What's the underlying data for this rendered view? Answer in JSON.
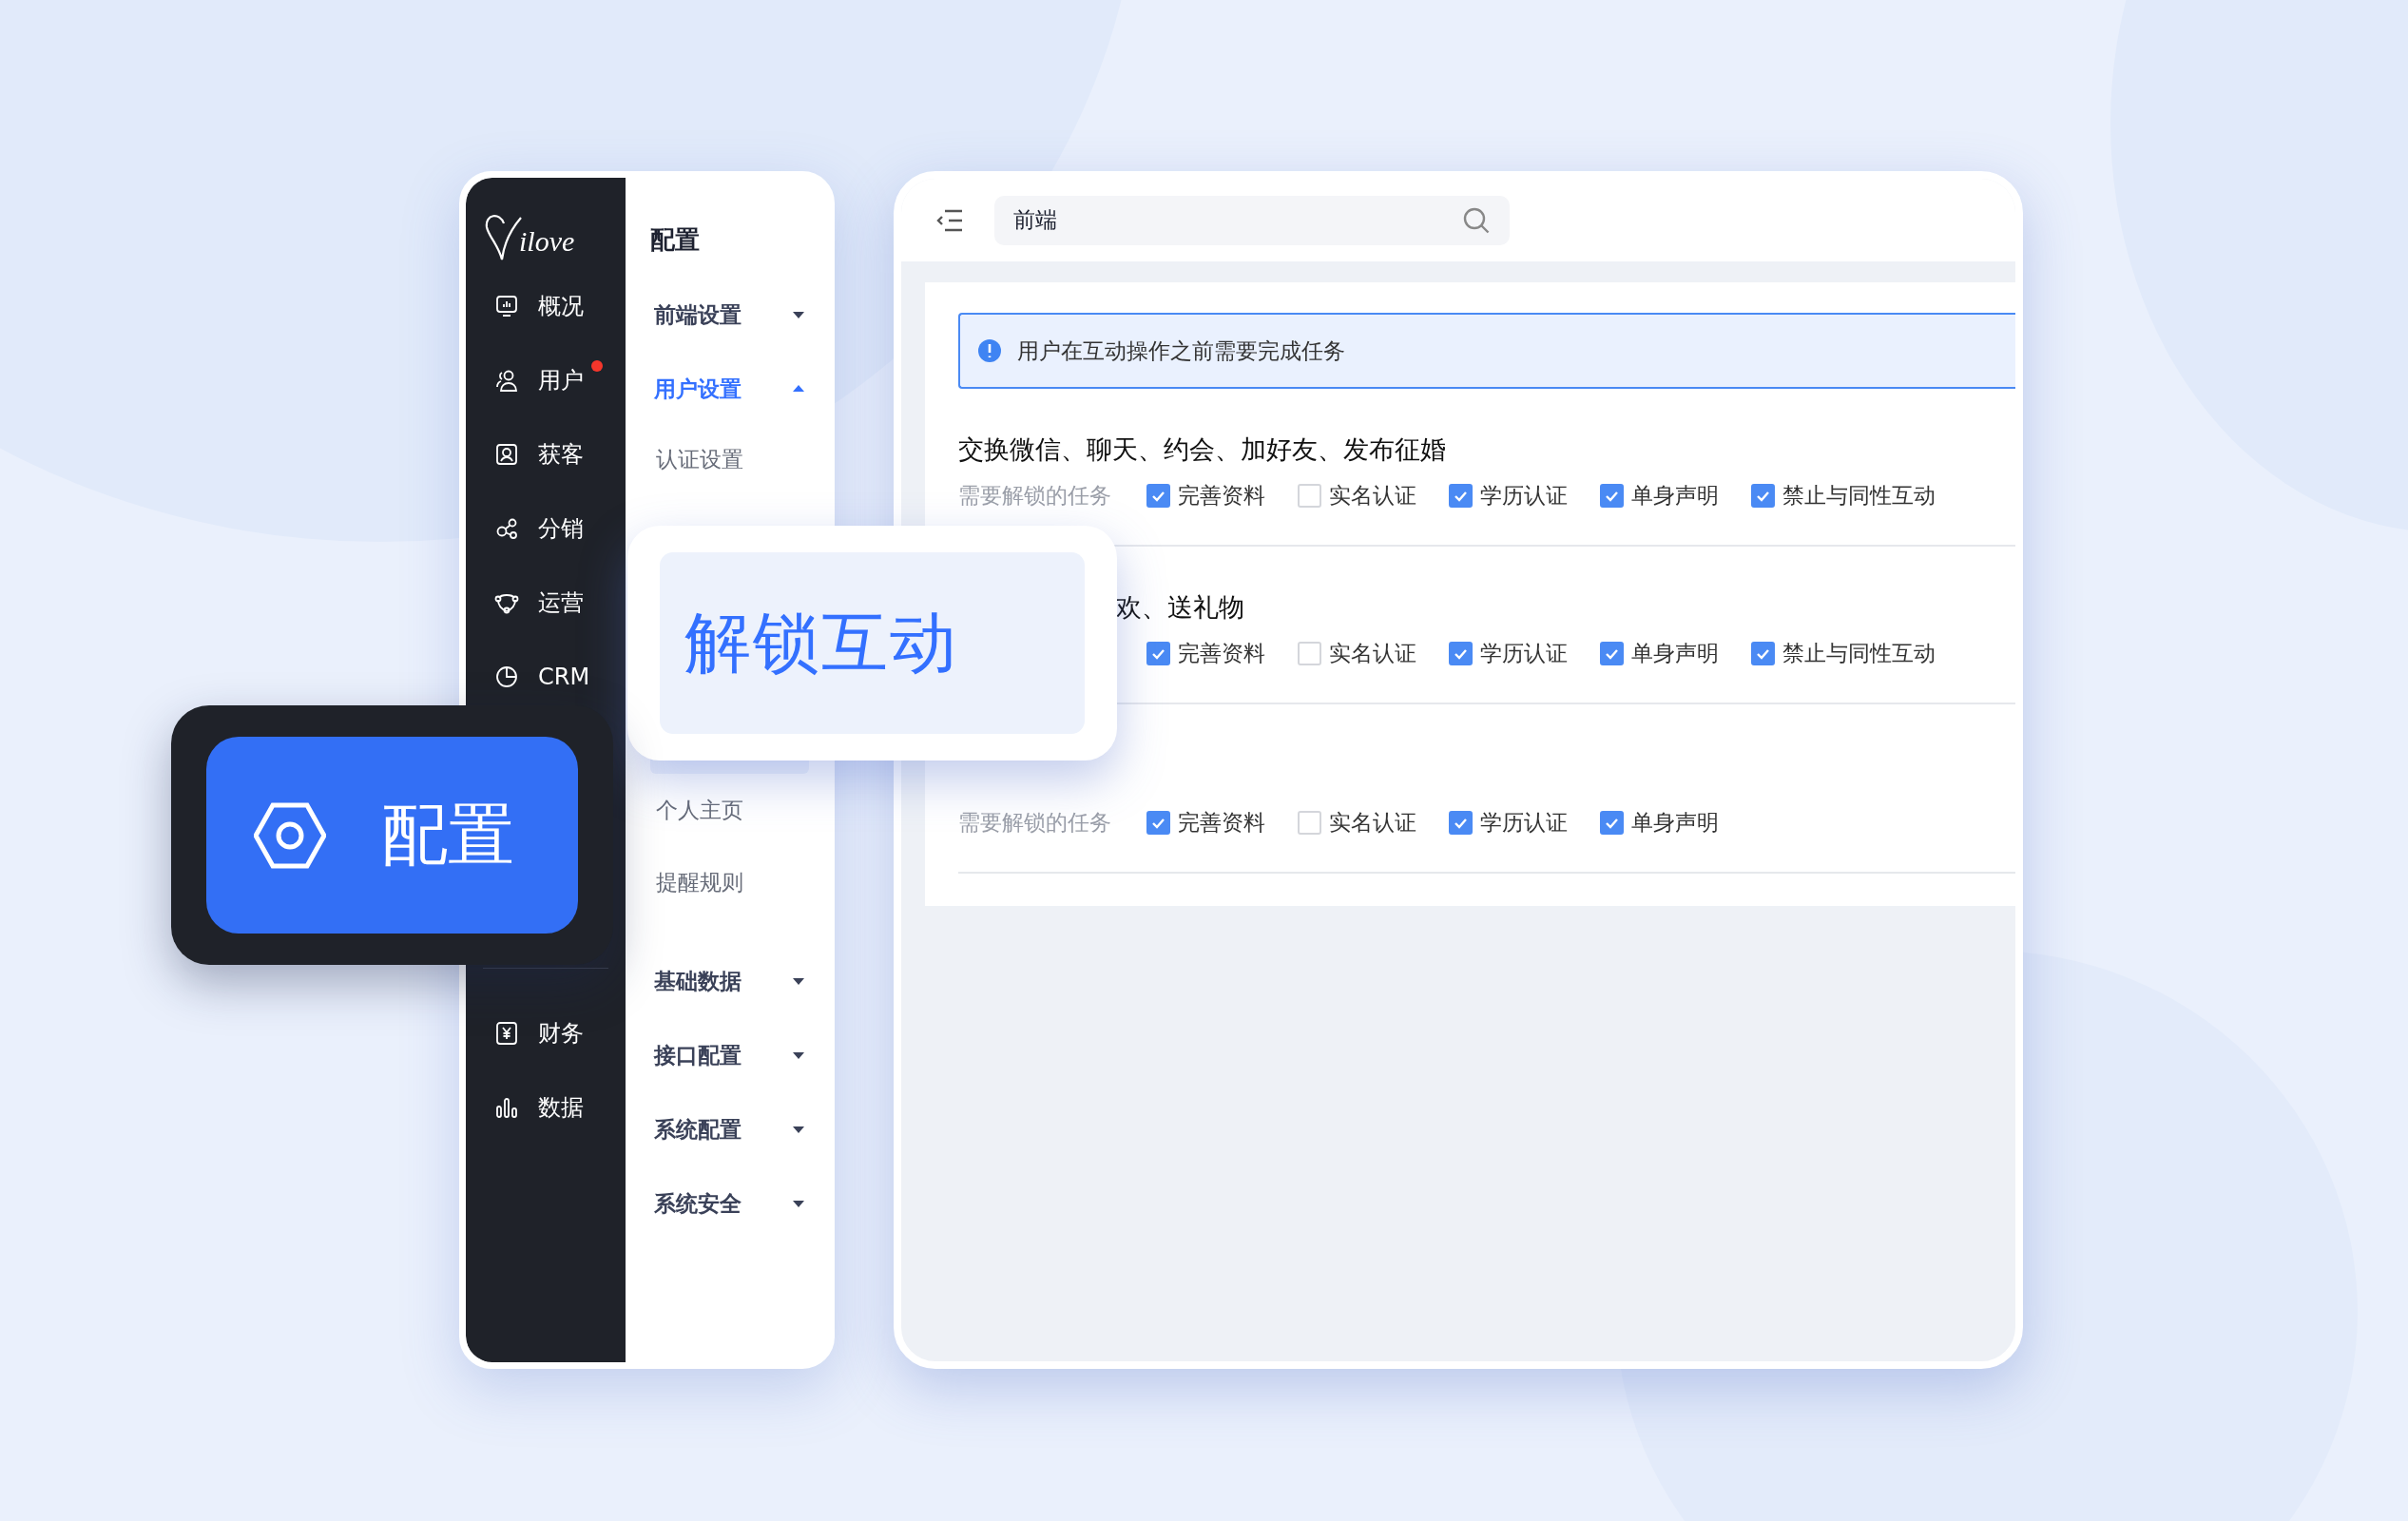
{
  "sidebar": {
    "logo": "ilove",
    "items": [
      {
        "label": "概况",
        "badge": false
      },
      {
        "label": "用户",
        "badge": true
      },
      {
        "label": "获客",
        "badge": false
      },
      {
        "label": "分销",
        "badge": false
      },
      {
        "label": "运营",
        "badge": false
      },
      {
        "label": "CRM",
        "badge": false
      }
    ],
    "bottom_items": [
      {
        "label": "财务",
        "badge": false
      },
      {
        "label": "数据",
        "badge": false
      }
    ]
  },
  "settings_menu": {
    "title": "配置",
    "groups": [
      {
        "label": "前端设置",
        "expanded": false,
        "selected": false
      },
      {
        "label": "用户设置",
        "expanded": true,
        "selected": true,
        "children": [
          {
            "label": "认证设置"
          },
          {
            "label": "个人主页"
          },
          {
            "label": "提醒规则"
          }
        ]
      },
      {
        "label": "基础数据",
        "expanded": false,
        "selected": false
      },
      {
        "label": "接口配置",
        "expanded": false,
        "selected": false
      },
      {
        "label": "系统配置",
        "expanded": false,
        "selected": false
      },
      {
        "label": "系统安全",
        "expanded": false,
        "selected": false
      }
    ]
  },
  "toolbar": {
    "search": {
      "value": "前端"
    }
  },
  "alert": "用户在互动操作之前需要完成任务",
  "sections": [
    {
      "title": "交换微信、聊天、约会、加好友、发布征婚",
      "covered": false,
      "label": "需要解锁的任务",
      "options": [
        {
          "label": "完善资料",
          "checked": true
        },
        {
          "label": "实名认证",
          "checked": false
        },
        {
          "label": "学历认证",
          "checked": true
        },
        {
          "label": "单身声明",
          "checked": true
        },
        {
          "label": "禁止与同性互动",
          "checked": true
        }
      ]
    },
    {
      "title": "欢、送礼物",
      "covered": true,
      "options": [
        {
          "label": "完善资料",
          "checked": true
        },
        {
          "label": "实名认证",
          "checked": false
        },
        {
          "label": "学历认证",
          "checked": true
        },
        {
          "label": "单身声明",
          "checked": true
        },
        {
          "label": "禁止与同性互动",
          "checked": true
        }
      ]
    },
    {
      "label": "需要解锁的任务",
      "options": [
        {
          "label": "完善资料",
          "checked": true
        },
        {
          "label": "实名认证",
          "checked": false
        },
        {
          "label": "学历认证",
          "checked": true
        },
        {
          "label": "单身声明",
          "checked": true
        }
      ]
    }
  ],
  "popup": {
    "text": "解锁互动"
  },
  "config_button": {
    "label": "配置"
  }
}
